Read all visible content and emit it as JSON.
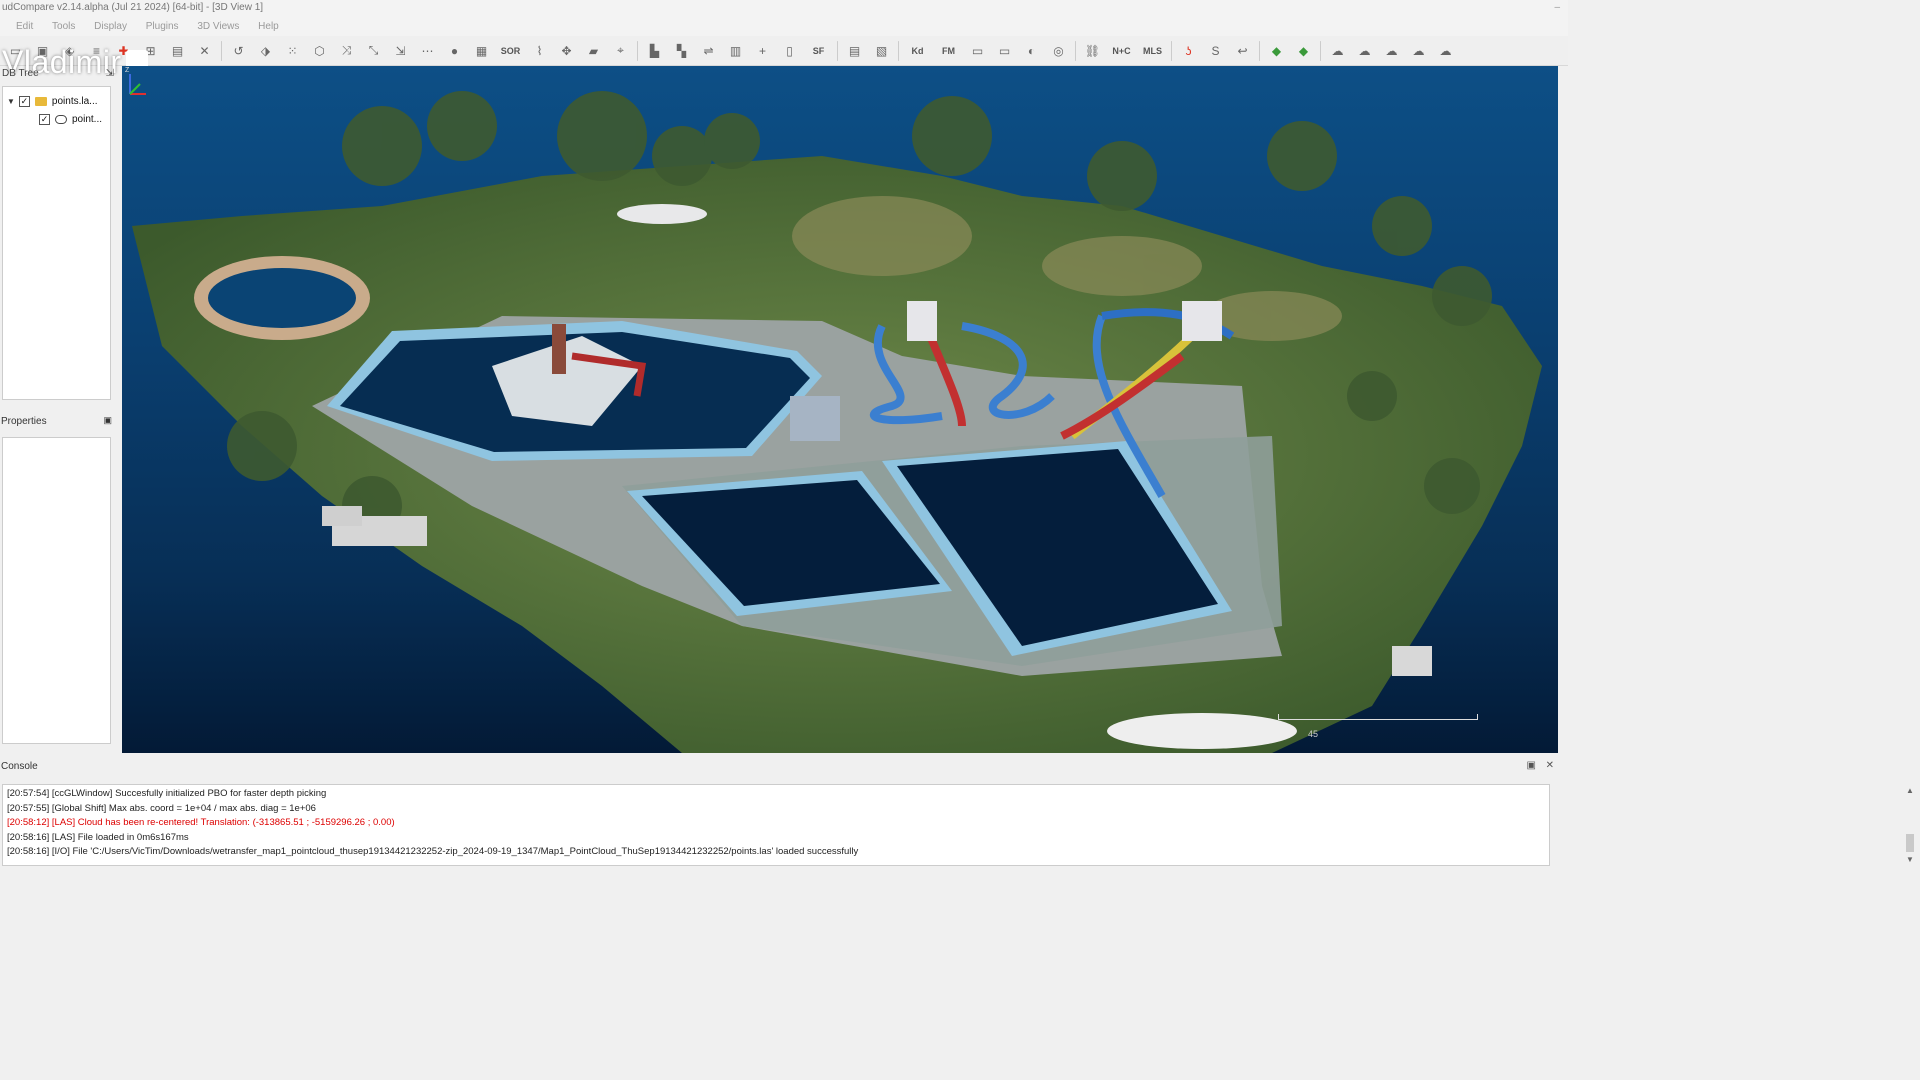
{
  "window": {
    "title": "udCompare v2.14.alpha (Jul 21 2024) [64-bit] - [3D View 1]"
  },
  "menu": [
    "Edit",
    "Tools",
    "Display",
    "Plugins",
    "3D Views",
    "Help"
  ],
  "toolbar": {
    "sor_label": "SOR",
    "sf_label": "SF",
    "nc_label": "N+C",
    "mls_label": "MLS",
    "kd_label": "Kd",
    "fm_label": "FM"
  },
  "watermark": {
    "text": "Vladimir"
  },
  "db_tree": {
    "header": "DB Tree",
    "items": [
      {
        "label": "points.la...",
        "checked": true,
        "expanded": true
      },
      {
        "label": "point...",
        "checked": true
      }
    ]
  },
  "properties": {
    "header": "Properties"
  },
  "view": {
    "scale_label": "45",
    "axis_z_label": "Z"
  },
  "console": {
    "header": "Console",
    "lines": [
      {
        "text": "[20:57:54] [ccGLWindow] Succesfully initialized PBO for faster depth picking",
        "level": "info"
      },
      {
        "text": "[20:57:55] [Global Shift] Max abs. coord = 1e+04 / max abs. diag = 1e+06",
        "level": "info"
      },
      {
        "text": "[20:58:12] [LAS] Cloud has been re-centered! Translation: (-313865.51 ; -5159296.26 ; 0.00)",
        "level": "error"
      },
      {
        "text": "[20:58:16] [LAS] File loaded in 0m6s167ms",
        "level": "info"
      },
      {
        "text": "[20:58:16] [I/O] File 'C:/Users/VicTim/Downloads/wetransfer_map1_pointcloud_thusep19134421232252-zip_2024-09-19_1347/Map1_PointCloud_ThuSep19134421232252/points.las' loaded successfully",
        "level": "info"
      }
    ]
  },
  "colors": {
    "view_background": "#0a3f70",
    "error_text": "#dd0000"
  }
}
